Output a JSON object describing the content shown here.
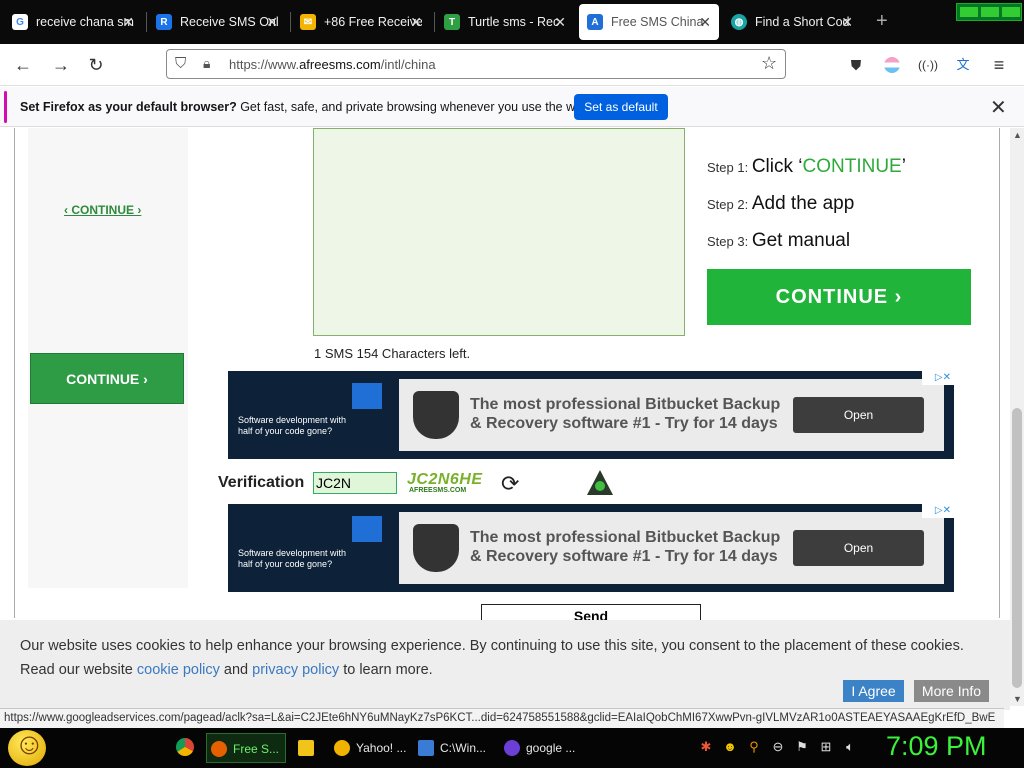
{
  "browser": {
    "tabs": [
      {
        "title": "receive chana sm",
        "icon": "google-icon",
        "color": "#4285f4",
        "active": false
      },
      {
        "title": "Receive SMS Onl",
        "icon": "receive-sms-icon",
        "color": "#1a73e8",
        "active": false
      },
      {
        "title": "+86 Free Receive",
        "icon": "receive-free-sms-icon",
        "color": "#f2b400",
        "active": false
      },
      {
        "title": "Turtle sms - Rec",
        "icon": "turtle-icon",
        "color": "#2ea043",
        "active": false
      },
      {
        "title": "Free SMS China",
        "icon": "afreesms-icon",
        "color": "#1f6fd6",
        "active": true
      },
      {
        "title": "Find a Short Cod",
        "icon": "globe-icon",
        "color": "#1aa3a3",
        "active": false
      }
    ],
    "url_prefix": "https://www.",
    "url_domain": "afreesms.com",
    "url_path": "/intl/china",
    "notification": {
      "bold": "Set Firefox as your default browser?",
      "text": " Get fast, safe, and private browsing whenever you use the web.",
      "button": "Set as default"
    }
  },
  "page": {
    "continue_link": "‹ CONTINUE ›",
    "continue_small": "CONTINUE ›",
    "char_count": "1 SMS 154 Characters left.",
    "steps": [
      {
        "prefix": "Step 1:",
        "text_a": "Click ‘",
        "highlight": "CONTINUE",
        "text_b": "’"
      },
      {
        "prefix": "Step 2:",
        "text_a": "Add the app",
        "highlight": "",
        "text_b": ""
      },
      {
        "prefix": "Step 3:",
        "text_a": "Get manual",
        "highlight": "",
        "text_b": ""
      }
    ],
    "continue_big": "CONTINUE  ›",
    "ads": [
      {
        "small_text": "Software development with half of your code gone?",
        "headline": "The most professional Bitbucket Backup & Recovery software #1 - Try for 14 days",
        "button": "Open"
      },
      {
        "small_text": "Software development with half of your code gone?",
        "headline": "The most professional Bitbucket Backup & Recovery software #1 - Try for 14 days",
        "button": "Open"
      }
    ],
    "verification_label": "Verification",
    "verification_value": "JC2N",
    "captcha_text": "JC2N6HE",
    "captcha_site": "AFREESMS.COM",
    "send_button": "Send",
    "cookie": {
      "text_a": "Our website uses cookies to help enhance your browsing experience. By continuing to use this site, you consent to the placement of these cookies. Read our website ",
      "link1": "cookie policy",
      "text_b": " and ",
      "link2": "privacy policy",
      "text_c": " to learn more.",
      "agree": "I Agree",
      "more": "More Info"
    },
    "status_url": "https://www.googleadservices.com/pagead/aclk?sa=L&ai=C2JEte6hNY6uMNayKz7sP6KCT...did=624758551588&gclid=EAIaIQobChMI67XwwPvn-gIVLMVzAR1o0ASTEAEYASAAEgKrEfD_BwE"
  },
  "taskbar": {
    "items": [
      {
        "label": "Free S...",
        "color": "#e66000",
        "active": true
      },
      {
        "label": "",
        "color": "#f0c419",
        "active": false
      },
      {
        "label": "Yahoo! ...",
        "color": "#f0b400",
        "active": false
      },
      {
        "label": "C:\\Win...",
        "color": "#3a7bd5",
        "active": false
      },
      {
        "label": "google ...",
        "color": "#6b3fd6",
        "active": false
      }
    ],
    "clock": "7:09 PM"
  }
}
